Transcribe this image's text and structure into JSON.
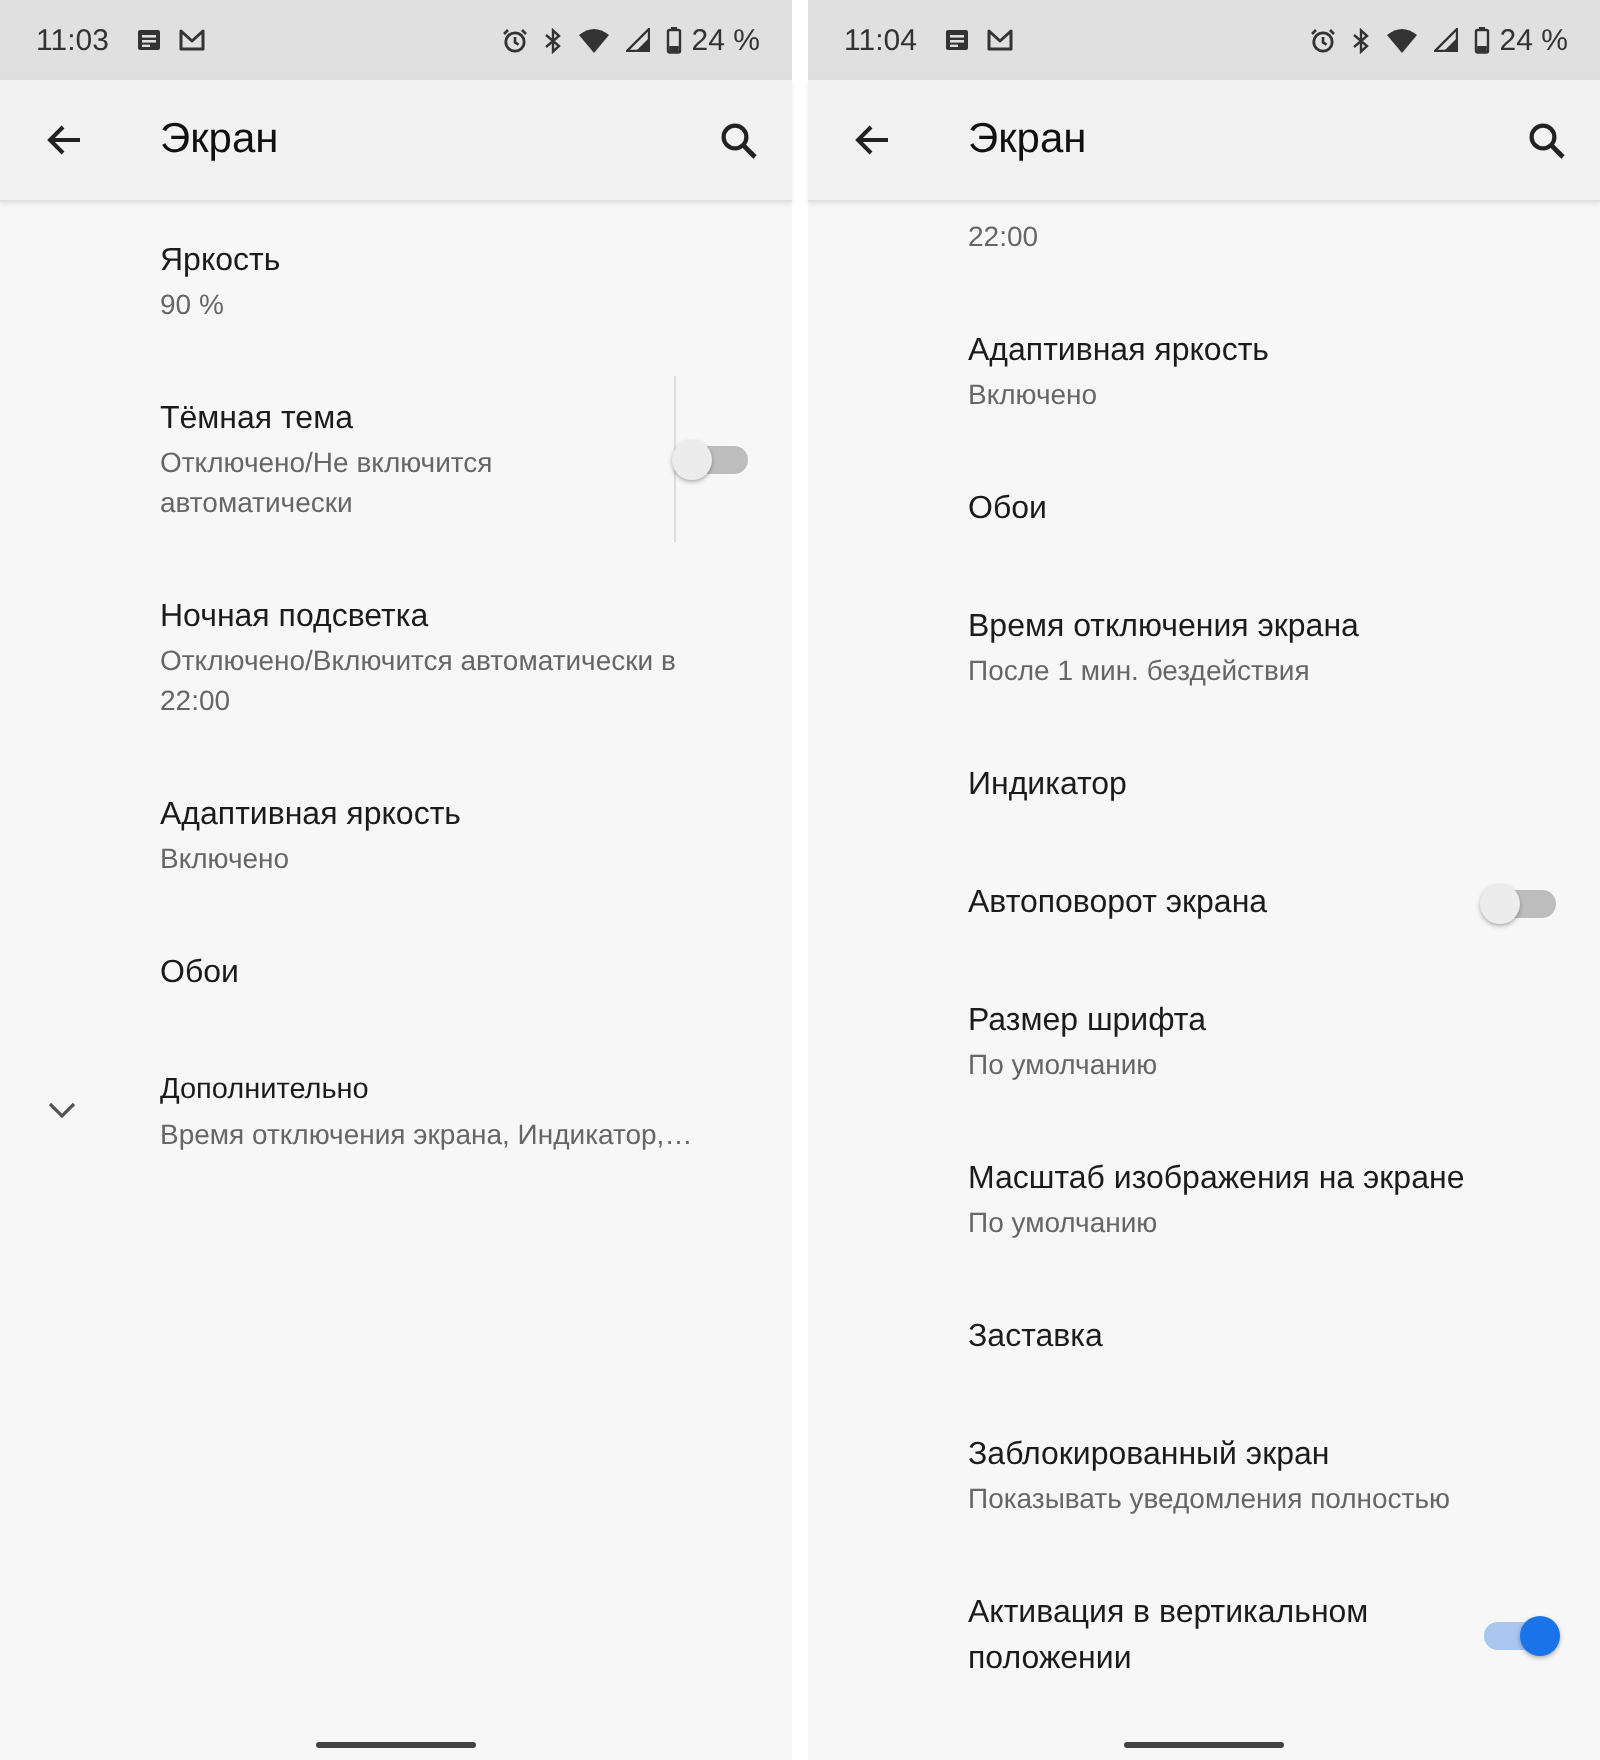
{
  "panels": [
    {
      "status_bar": {
        "time": "11:03",
        "battery": "24 %"
      },
      "title": "Экран",
      "items": [
        {
          "kind": "setting",
          "title": "Яркость",
          "summary": "90 %"
        },
        {
          "kind": "toggle",
          "title": "Тёмная тема",
          "summary": "Отключено/Не включится автоматически",
          "on": false,
          "separator": true
        },
        {
          "kind": "setting",
          "title": "Ночная подсветка",
          "summary": "Отключено/Включится автоматически в 22:00"
        },
        {
          "kind": "setting",
          "title": "Адаптивная яркость",
          "summary": "Включено"
        },
        {
          "kind": "setting",
          "title": "Обои"
        },
        {
          "kind": "expand",
          "title": "Дополнительно",
          "summary": "Время отключения экрана, Индикатор,…"
        }
      ]
    },
    {
      "status_bar": {
        "time": "11:04",
        "battery": "24 %"
      },
      "title": "Экран",
      "items": [
        {
          "kind": "tail",
          "summary": "22:00"
        },
        {
          "kind": "setting",
          "title": "Адаптивная яркость",
          "summary": "Включено"
        },
        {
          "kind": "setting",
          "title": "Обои"
        },
        {
          "kind": "setting",
          "title": "Время отключения экрана",
          "summary": "После 1 мин. бездействия"
        },
        {
          "kind": "setting",
          "title": "Индикатор"
        },
        {
          "kind": "toggle",
          "title": "Автоповорот экрана",
          "on": false,
          "separator": false
        },
        {
          "kind": "setting",
          "title": "Размер шрифта",
          "summary": "По умолчанию"
        },
        {
          "kind": "setting",
          "title": "Масштаб изображения на экране",
          "summary": "По умолчанию"
        },
        {
          "kind": "setting",
          "title": "Заставка"
        },
        {
          "kind": "setting",
          "title": "Заблокированный экран",
          "summary": "Показывать уведомления полностью"
        },
        {
          "kind": "toggle",
          "title": "Активация в вертикальном положении",
          "on": true,
          "separator": false
        }
      ]
    }
  ]
}
